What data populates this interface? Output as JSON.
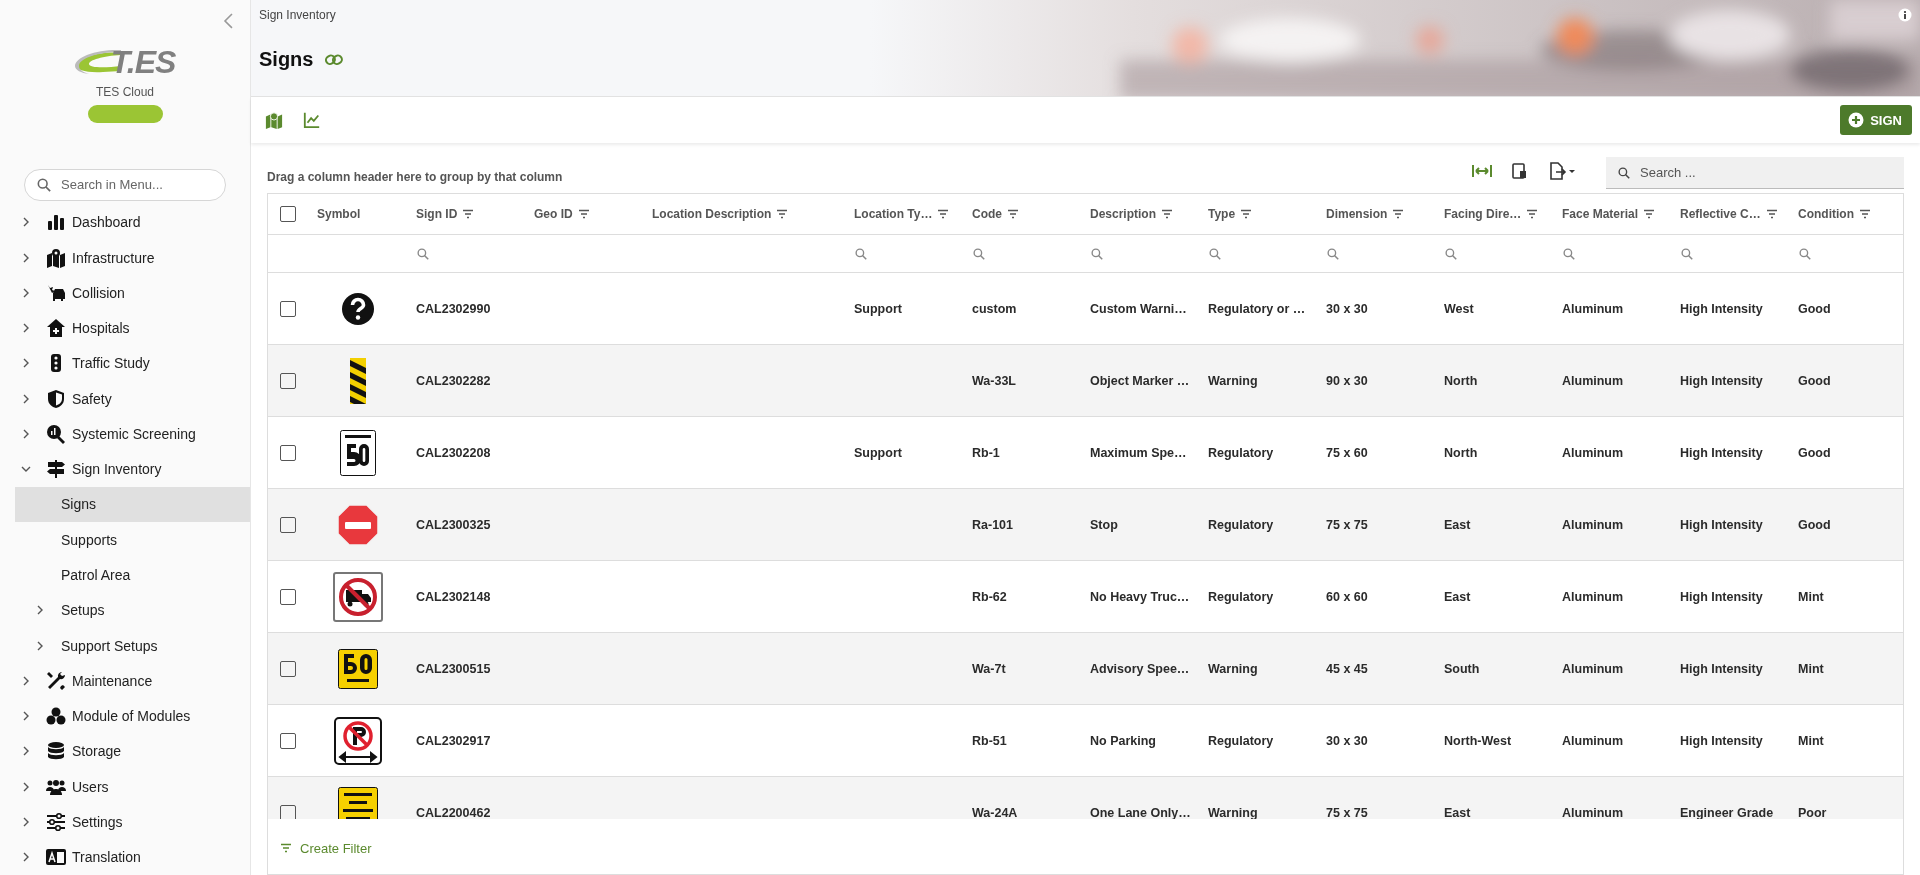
{
  "sidebar": {
    "logo_text": "T.ES",
    "app_name": "TES Cloud",
    "search": {
      "placeholder": "Search in Menu..."
    },
    "menu": [
      {
        "label": "Dashboard",
        "expanded": false,
        "selected": false
      },
      {
        "label": "Infrastructure",
        "expanded": false,
        "selected": false
      },
      {
        "label": "Collision",
        "expanded": false,
        "selected": false
      },
      {
        "label": "Hospitals",
        "expanded": false,
        "selected": false
      },
      {
        "label": "Traffic Study",
        "expanded": false,
        "selected": false
      },
      {
        "label": "Safety",
        "expanded": false,
        "selected": false
      },
      {
        "label": "Systemic Screening",
        "expanded": false,
        "selected": false
      },
      {
        "label": "Sign Inventory",
        "expanded": true,
        "selected": false,
        "children": [
          {
            "label": "Signs",
            "selected": true
          },
          {
            "label": "Supports",
            "selected": false
          },
          {
            "label": "Patrol Area",
            "selected": false
          },
          {
            "label": "Setups",
            "expanded": false,
            "selected": false
          },
          {
            "label": "Support Setups",
            "expanded": false,
            "selected": false
          }
        ]
      },
      {
        "label": "Maintenance",
        "expanded": false,
        "selected": false
      },
      {
        "label": "Module of Modules",
        "expanded": false,
        "selected": false
      },
      {
        "label": "Storage",
        "expanded": false,
        "selected": false
      },
      {
        "label": "Users",
        "expanded": false,
        "selected": false
      },
      {
        "label": "Settings",
        "expanded": false,
        "selected": false
      },
      {
        "label": "Translation",
        "expanded": false,
        "selected": false
      }
    ]
  },
  "header": {
    "breadcrumb": "Sign Inventory",
    "title": "Signs"
  },
  "toolbar": {
    "add_button": "SIGN"
  },
  "grid": {
    "group_panel": "Drag a column header here to group by that column",
    "search": {
      "placeholder": "Search ..."
    },
    "header_checked": false,
    "columns": [
      {
        "label": "Symbol",
        "filter_menu": false,
        "search_cell": false
      },
      {
        "label": "Sign ID",
        "filter_menu": true,
        "search_cell": true
      },
      {
        "label": "Geo ID",
        "filter_menu": true,
        "search_cell": false
      },
      {
        "label": "Location Description",
        "filter_menu": true,
        "search_cell": false
      },
      {
        "label": "Location Ty…",
        "filter_menu": true,
        "search_cell": true
      },
      {
        "label": "Code",
        "filter_menu": true,
        "search_cell": true
      },
      {
        "label": "Description",
        "filter_menu": true,
        "search_cell": true
      },
      {
        "label": "Type",
        "filter_menu": true,
        "search_cell": true
      },
      {
        "label": "Dimension",
        "filter_menu": true,
        "search_cell": true
      },
      {
        "label": "Facing Dire…",
        "filter_menu": true,
        "search_cell": true
      },
      {
        "label": "Face Material",
        "filter_menu": true,
        "search_cell": true
      },
      {
        "label": "Reflective C…",
        "filter_menu": true,
        "search_cell": true
      },
      {
        "label": "Condition",
        "filter_menu": true,
        "search_cell": true
      }
    ],
    "rows": [
      {
        "checked": false,
        "symbol": {
          "kind": "question"
        },
        "sign_id": "CAL2302990",
        "location_type": "Support",
        "code": "custom",
        "description": "Custom Warni…",
        "type": "Regulatory or …",
        "dimension": "30 x 30",
        "facing_direction": "West",
        "face_material": "Aluminum",
        "reflective": "High Intensity",
        "condition": "Good"
      },
      {
        "checked": false,
        "symbol": {
          "kind": "hazard-marker"
        },
        "sign_id": "CAL2302282",
        "code": "Wa-33L",
        "description": "Object Marker …",
        "type": "Warning",
        "dimension": "90 x 30",
        "facing_direction": "North",
        "face_material": "Aluminum",
        "reflective": "High Intensity",
        "condition": "Good"
      },
      {
        "checked": false,
        "symbol": {
          "kind": "speed-limit"
        },
        "sign_id": "CAL2302208",
        "location_type": "Support",
        "code": "Rb-1",
        "description": "Maximum Spe…",
        "type": "Regulatory",
        "dimension": "75 x 60",
        "facing_direction": "North",
        "face_material": "Aluminum",
        "reflective": "High Intensity",
        "condition": "Good"
      },
      {
        "checked": false,
        "symbol": {
          "kind": "stop"
        },
        "sign_id": "CAL2300325",
        "code": "Ra-101",
        "description": "Stop",
        "type": "Regulatory",
        "dimension": "75 x 75",
        "facing_direction": "East",
        "face_material": "Aluminum",
        "reflective": "High Intensity",
        "condition": "Good"
      },
      {
        "checked": false,
        "symbol": {
          "kind": "no-trucks"
        },
        "sign_id": "CAL2302148",
        "code": "Rb-62",
        "description": "No Heavy Truc…",
        "type": "Regulatory",
        "dimension": "60 x 60",
        "facing_direction": "East",
        "face_material": "Aluminum",
        "reflective": "High Intensity",
        "condition": "Mint"
      },
      {
        "checked": false,
        "symbol": {
          "kind": "advisory-speed"
        },
        "sign_id": "CAL2300515",
        "code": "Wa-7t",
        "description": "Advisory Spee…",
        "type": "Warning",
        "dimension": "45 x 45",
        "facing_direction": "South",
        "face_material": "Aluminum",
        "reflective": "High Intensity",
        "condition": "Mint"
      },
      {
        "checked": false,
        "symbol": {
          "kind": "no-parking"
        },
        "sign_id": "CAL2302917",
        "code": "Rb-51",
        "description": "No Parking",
        "type": "Regulatory",
        "dimension": "30 x 30",
        "facing_direction": "North-West",
        "face_material": "Aluminum",
        "reflective": "High Intensity",
        "condition": "Mint"
      },
      {
        "checked": false,
        "symbol": {
          "kind": "one-lane"
        },
        "sign_id": "CAL2200462",
        "code": "Wa-24A",
        "description": "One Lane Only…",
        "type": "Warning",
        "dimension": "75 x 75",
        "facing_direction": "East",
        "face_material": "Aluminum",
        "reflective": "Engineer Grade",
        "condition": "Poor"
      }
    ],
    "footer": {
      "create_filter": "Create Filter"
    }
  }
}
